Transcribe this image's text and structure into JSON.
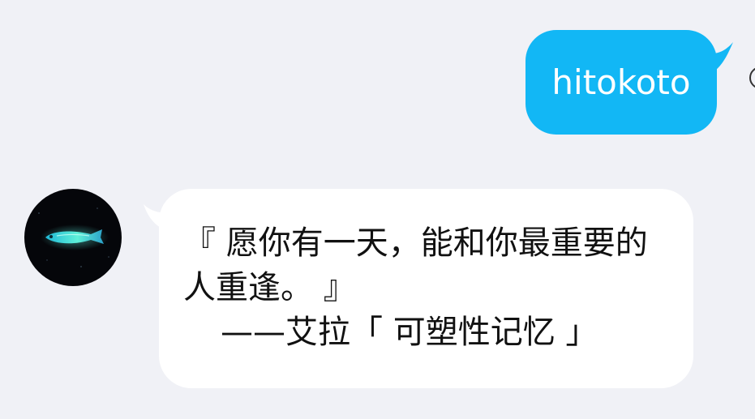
{
  "conversation": {
    "outgoing": {
      "text": "hitokoto",
      "bubble_color": "#12b7f5",
      "text_color": "#ffffff"
    },
    "incoming": {
      "quote": "『 愿你有一天，能和你最重要的人重逢。 』",
      "source": "——艾拉「 可塑性记忆 」",
      "bubble_color": "#ffffff",
      "text_color": "#111111",
      "avatar_icon": "glowing-fish-avatar"
    }
  },
  "colors": {
    "background": "#f0f1f6",
    "accent": "#12b7f5"
  }
}
